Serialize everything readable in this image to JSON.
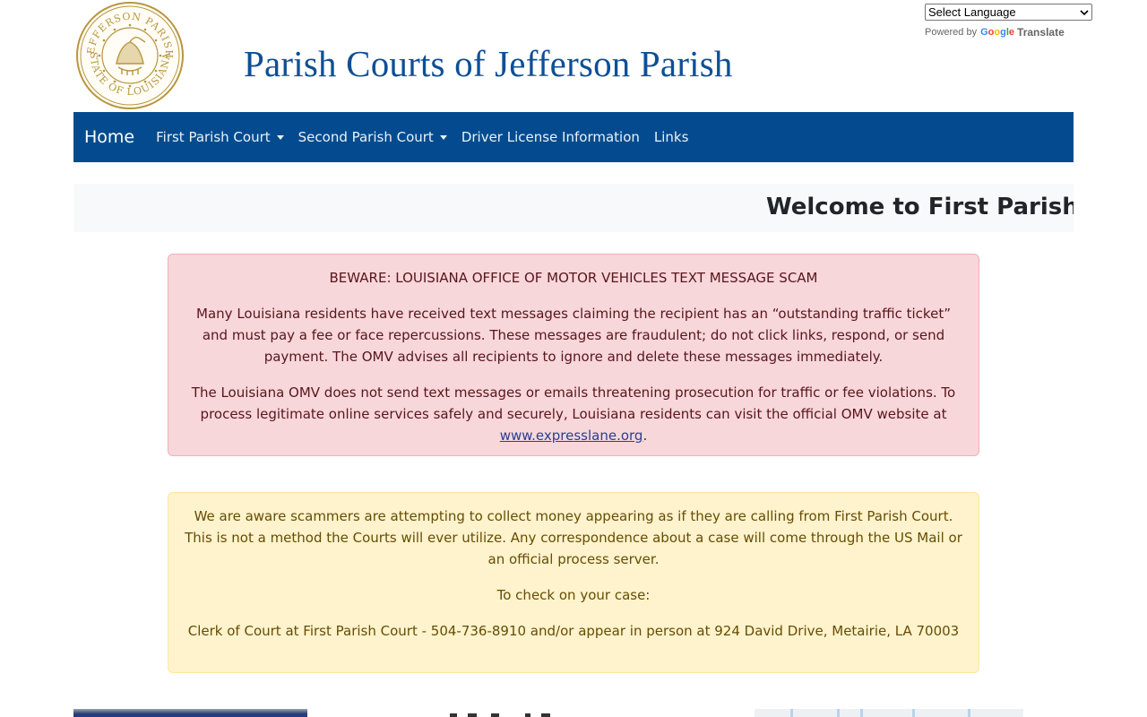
{
  "header": {
    "seal": {
      "top_text": "JEFFERSON PARISH",
      "bottom_text": "STATE OF LOUISIANA",
      "color": "#b8963e"
    },
    "site_title": "Parish Courts of Jefferson Parish",
    "title_color": "#0e4f96"
  },
  "translate": {
    "select_value": "Select Language",
    "powered_by": "Powered by",
    "google": "Google",
    "translate_label": "Translate"
  },
  "navbar": {
    "background": "#034b8e",
    "brand": "Home",
    "items": [
      {
        "label": "First Parish Court",
        "dropdown": true
      },
      {
        "label": "Second Parish Court",
        "dropdown": true
      },
      {
        "label": "Driver License Information",
        "dropdown": false
      },
      {
        "label": "Links",
        "dropdown": false
      }
    ]
  },
  "banner": {
    "welcome_text": "Welcome to First Parish Court"
  },
  "alerts": {
    "omv": {
      "heading": "BEWARE: LOUISIANA OFFICE OF MOTOR VEHICLES TEXT MESSAGE SCAM",
      "paragraph1": "Many Louisiana residents have received text messages claiming the recipient has an “outstanding traffic ticket” and must pay a fee or face repercussions. These messages are fraudulent; do not click links, respond, or send payment. The OMV advises all recipients to ignore and delete these messages immediately.",
      "paragraph2_prefix": "The Louisiana OMV does not send text messages or emails threatening prosecution for traffic or fee violations. To process legitimate online services safely and securely, Louisiana residents can visit the official OMV website at ",
      "link_text": "www.expresslane.org",
      "paragraph2_suffix": "."
    },
    "scam": {
      "paragraph1": "We are aware scammers are attempting to collect money appearing as if they are calling from First Parish Court. This is not a method the Courts will ever utilize. Any correspondence about a case will come through the US Mail or an official process server.",
      "paragraph2": "To check on your case:",
      "paragraph3": "Clerk of Court at First Parish Court - 504-736-8910 and/or appear in person at 924 David Drive, Metairie, LA 70003"
    }
  }
}
